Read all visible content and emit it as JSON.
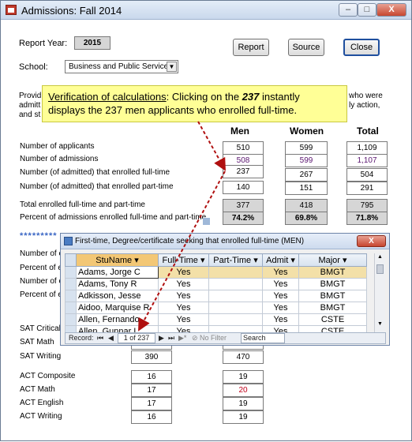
{
  "window": {
    "title": "Admissions:  Fall 2014",
    "min": "–",
    "max": "□",
    "close": "X"
  },
  "form": {
    "report_year_label": "Report Year:",
    "report_year": "2015",
    "school_label": "School:",
    "school_value": "Business and Public Service",
    "report_btn": "Report",
    "source_btn": "Source",
    "close_btn": "Close",
    "provid_text": "Provid",
    "admitt_text": "admitt",
    "andst_text": "and st",
    "right_text1": "who were",
    "right_text2": "ly action,"
  },
  "callout": {
    "part1": "Verification of calculations",
    "part2": ":  Clicking on the ",
    "part3": "237",
    "part4": " instantly",
    "line2": "displays the 237 men applicants who enrolled full-time."
  },
  "columns": {
    "men": "Men",
    "women": "Women",
    "total": "Total"
  },
  "rows": [
    {
      "label": "Number of applicants",
      "men": "510",
      "women": "599",
      "total": "1,109"
    },
    {
      "label": "Number of admissions",
      "men": "508",
      "women": "599",
      "total": "1,107"
    },
    {
      "label": "Number (of admitted) that enrolled full-time",
      "men": "237",
      "women": "267",
      "total": "504"
    },
    {
      "label": "Number (of admitted) that enrolled part-time",
      "men": "140",
      "women": "151",
      "total": "291"
    },
    {
      "label": "Total enrolled full-time and part-time",
      "men": "377",
      "women": "418",
      "total": "795"
    },
    {
      "label": "Percent of admissions enrolled full-time and part-time",
      "men": "74.2%",
      "women": "69.8%",
      "total": "71.8%"
    }
  ],
  "stars": "*********",
  "lower_labels": [
    "Number of e",
    "Percent of e",
    "Number of e",
    "Percent of e"
  ],
  "sat": [
    {
      "label": "SAT Critical",
      "col1": "",
      "col2": ""
    },
    {
      "label": "SAT Math",
      "col1": "",
      "col2": ""
    },
    {
      "label": "SAT Writing",
      "col1": "390",
      "col2": "470"
    }
  ],
  "act": [
    {
      "label": "ACT Composite",
      "col1": "16",
      "col2": "19"
    },
    {
      "label": "ACT Math",
      "col1": "17",
      "col2": "20"
    },
    {
      "label": "ACT English",
      "col1": "17",
      "col2": "19"
    },
    {
      "label": "ACT Writing",
      "col1": "16",
      "col2": "19"
    }
  ],
  "subwindow": {
    "title": "First-time, Degree/certificate seeking that enrolled full-time (MEN)",
    "close": "X",
    "headers": [
      "StuName",
      "Full-Time",
      "Part-Time",
      "Admit",
      "Major"
    ],
    "rows": [
      [
        "Adams, Jorge C",
        "Yes",
        "",
        "Yes",
        "BMGT"
      ],
      [
        "Adams, Tony R",
        "Yes",
        "",
        "Yes",
        "BMGT"
      ],
      [
        "Adkisson, Jesse",
        "Yes",
        "",
        "Yes",
        "BMGT"
      ],
      [
        "Aidoo, Marquise R",
        "Yes",
        "",
        "Yes",
        "BMGT"
      ],
      [
        "Allen, Fernando",
        "Yes",
        "",
        "Yes",
        "CSTE"
      ],
      [
        "Allen, Gunnar L",
        "Yes",
        "",
        "Yes",
        "CSTE"
      ]
    ],
    "nav": {
      "record_label": "Record:",
      "first": "⏮",
      "prev": "◀",
      "position": "1 of 237",
      "next": "▶",
      "last": "⏭",
      "new": "▶*",
      "filter": "No Filter",
      "search": "Search"
    }
  },
  "colors": {
    "callout_bg": "#ffff96",
    "arrow": "#b01010",
    "header_gray": "#d6d6d6"
  }
}
